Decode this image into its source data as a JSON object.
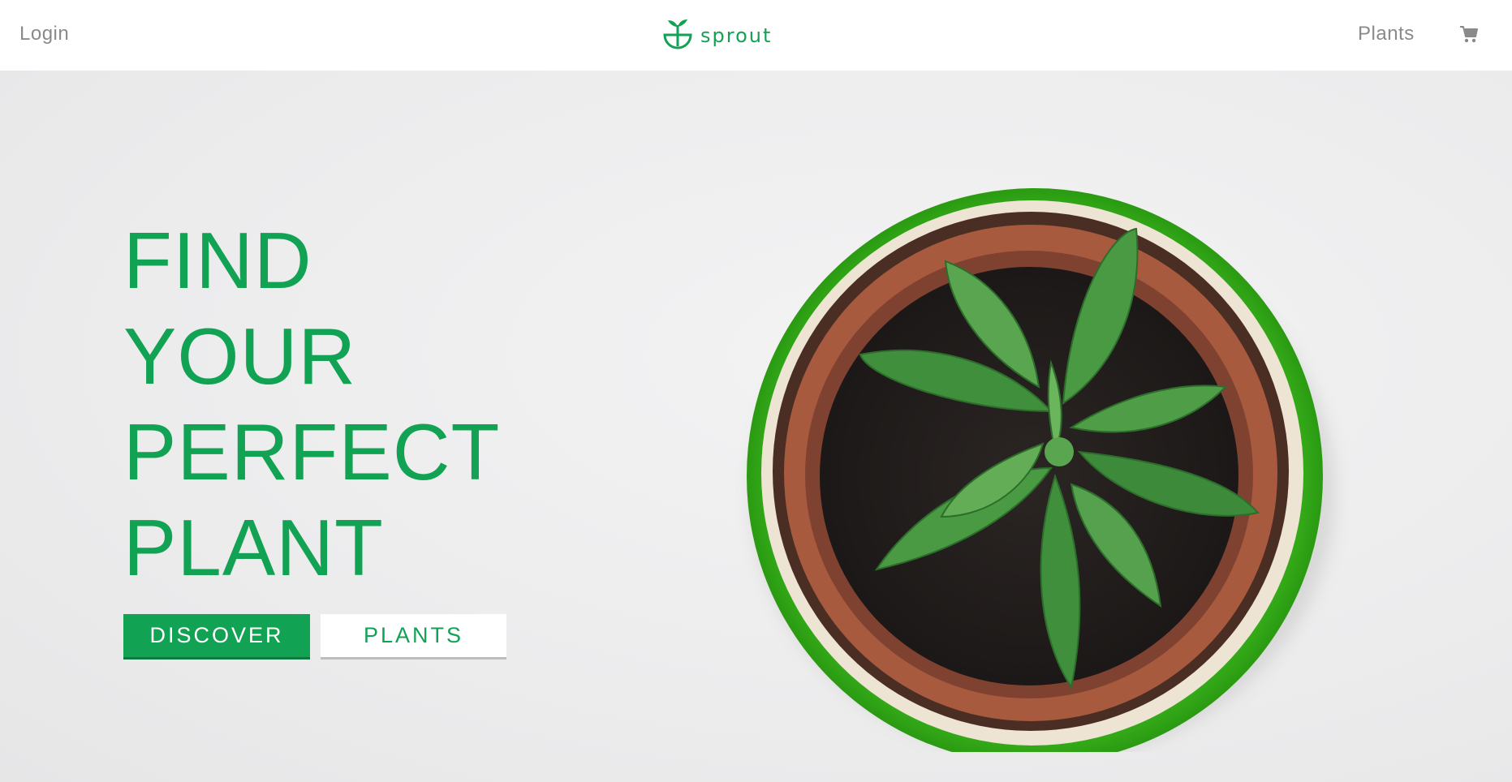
{
  "header": {
    "login_label": "Login",
    "logo_text": "sprout",
    "plants_label": "Plants",
    "cart_icon": "cart-icon"
  },
  "hero": {
    "title_lines": [
      "FIND",
      "YOUR",
      "PERFECT",
      "PLANT"
    ],
    "discover_label": "DISCOVER",
    "plants_label": "PLANTS",
    "image": "potted-seedling-photo"
  },
  "colors": {
    "brand": "#12a254",
    "nav_text": "#8a8a8a",
    "background": "#ececed"
  }
}
